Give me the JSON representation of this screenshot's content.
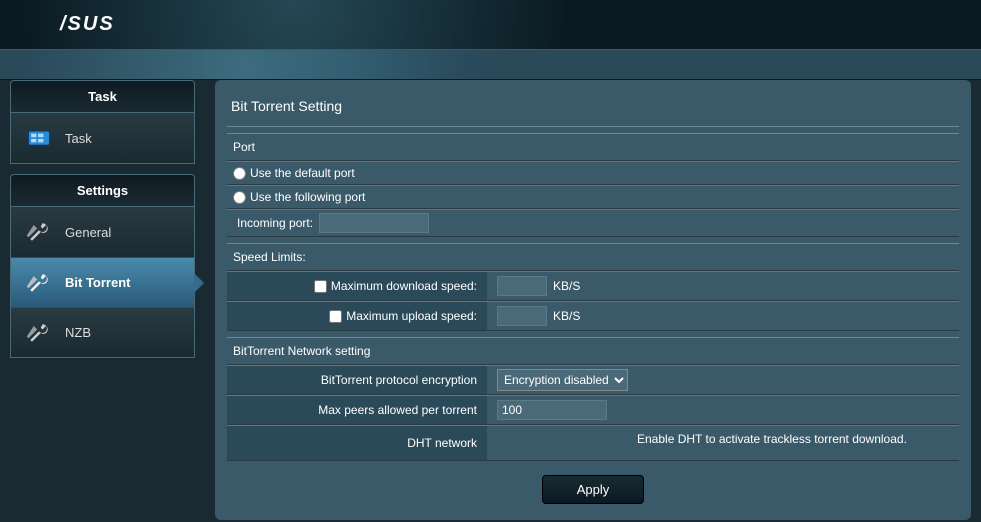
{
  "header": {
    "logo": "/SUS"
  },
  "sidebar": {
    "group1": {
      "title": "Task",
      "items": [
        {
          "label": "Task"
        }
      ]
    },
    "group2": {
      "title": "Settings",
      "items": [
        {
          "label": "General"
        },
        {
          "label": "Bit Torrent"
        },
        {
          "label": "NZB"
        }
      ]
    }
  },
  "page": {
    "title": "Bit Torrent Setting",
    "port": {
      "section": "Port",
      "default_label": "Use the default port",
      "following_label": "Use the following port",
      "incoming_label": "Incoming port:",
      "incoming_value": ""
    },
    "speed": {
      "section": "Speed Limits:",
      "max_dl_label": "Maximum download speed:",
      "max_dl_value": "",
      "max_ul_label": "Maximum upload speed:",
      "max_ul_value": "",
      "unit": "KB/S"
    },
    "network": {
      "section": "BitTorrent Network setting",
      "encryption_label": "BitTorrent protocol encryption",
      "encryption_value": "Encryption disabled",
      "max_peers_label": "Max peers allowed per torrent",
      "max_peers_value": "100",
      "dht_label": "DHT network",
      "dht_hint": "Enable DHT to activate trackless torrent download."
    },
    "apply": "Apply"
  }
}
